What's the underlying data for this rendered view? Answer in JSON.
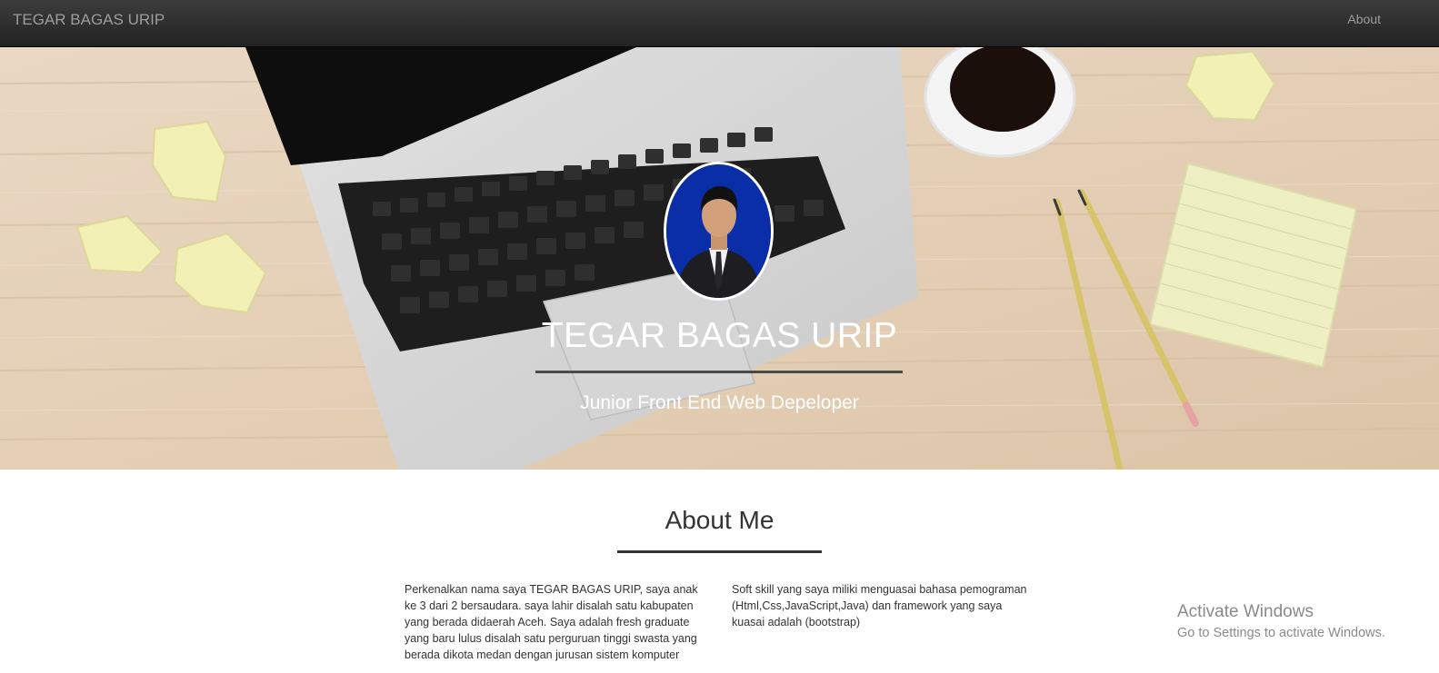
{
  "navbar": {
    "brand": "TEGAR BAGAS URIP",
    "about_link": "About"
  },
  "hero": {
    "title": "TEGAR BAGAS URIP",
    "subtitle": "Junior Front End Web Depeloper"
  },
  "about": {
    "title": "About Me",
    "left_text": "Perkenalkan nama saya TEGAR BAGAS URIP, saya anak ke 3 dari 2 bersaudara. saya lahir disalah satu kabupaten yang berada didaerah Aceh. Saya adalah fresh graduate yang baru lulus disalah satu perguruan tinggi swasta yang berada dikota medan dengan jurusan sistem komputer",
    "right_text": "Soft skill yang saya miliki menguasai bahasa pemograman (Html,Css,JavaScript,Java) dan framework yang saya kuasai adalah (bootstrap)"
  },
  "watermark": {
    "title": "Activate Windows",
    "subtitle": "Go to Settings to activate Windows."
  },
  "colors": {
    "navbar": "#222222",
    "nav_text": "#9d9d9d",
    "avatar_bg": "#0a2ea8",
    "text": "#333333"
  }
}
